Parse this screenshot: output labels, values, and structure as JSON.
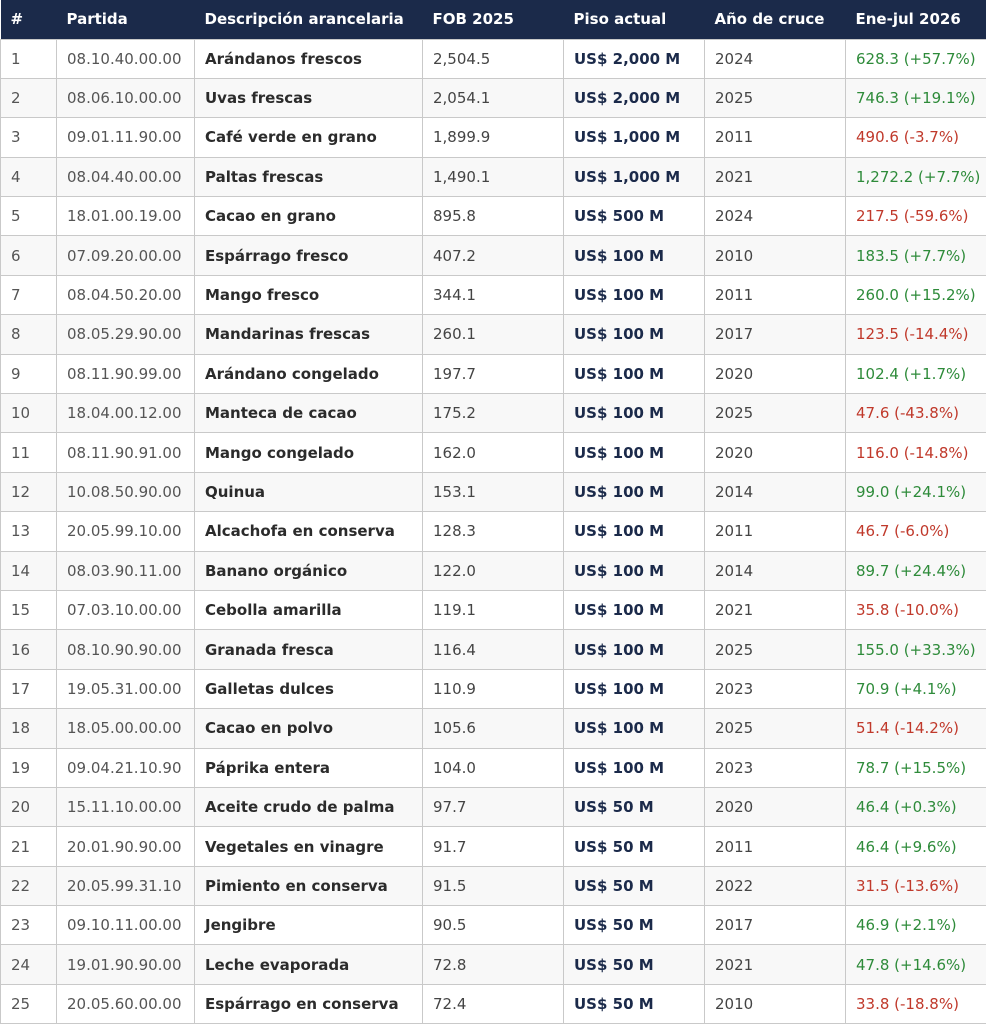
{
  "table": {
    "headers": [
      "#",
      "Partida",
      "Descripción arancelaria",
      "FOB 2025",
      "Piso actual",
      "Año de cruce",
      "Ene-jul 2026"
    ],
    "rows": [
      {
        "idx": "1",
        "partida": "08.10.40.00.00",
        "desc": "Arándanos frescos",
        "fob": "2,504.5",
        "piso": "US$ 2,000 M",
        "year": "2024",
        "ytd": "628.3  (+57.7%)",
        "trend": "pos"
      },
      {
        "idx": "2",
        "partida": "08.06.10.00.00",
        "desc": "Uvas frescas",
        "fob": "2,054.1",
        "piso": "US$ 2,000 M",
        "year": "2025",
        "ytd": "746.3  (+19.1%)",
        "trend": "pos"
      },
      {
        "idx": "3",
        "partida": "09.01.11.90.00",
        "desc": "Café verde en grano",
        "fob": "1,899.9",
        "piso": "US$ 1,000 M",
        "year": "2011",
        "ytd": "490.6  (-3.7%)",
        "trend": "neg"
      },
      {
        "idx": "4",
        "partida": "08.04.40.00.00",
        "desc": "Paltas frescas",
        "fob": "1,490.1",
        "piso": "US$ 1,000 M",
        "year": "2021",
        "ytd": "1,272.2  (+7.7%)",
        "trend": "pos"
      },
      {
        "idx": "5",
        "partida": "18.01.00.19.00",
        "desc": "Cacao en grano",
        "fob": "895.8",
        "piso": "US$ 500 M",
        "year": "2024",
        "ytd": "217.5  (-59.6%)",
        "trend": "neg"
      },
      {
        "idx": "6",
        "partida": "07.09.20.00.00",
        "desc": "Espárrago fresco",
        "fob": "407.2",
        "piso": "US$ 100 M",
        "year": "2010",
        "ytd": "183.5  (+7.7%)",
        "trend": "pos"
      },
      {
        "idx": "7",
        "partida": "08.04.50.20.00",
        "desc": "Mango fresco",
        "fob": "344.1",
        "piso": "US$ 100 M",
        "year": "2011",
        "ytd": "260.0  (+15.2%)",
        "trend": "pos"
      },
      {
        "idx": "8",
        "partida": "08.05.29.90.00",
        "desc": "Mandarinas frescas",
        "fob": "260.1",
        "piso": "US$ 100 M",
        "year": "2017",
        "ytd": "123.5  (-14.4%)",
        "trend": "neg"
      },
      {
        "idx": "9",
        "partida": "08.11.90.99.00",
        "desc": "Arándano congelado",
        "fob": "197.7",
        "piso": "US$ 100 M",
        "year": "2020",
        "ytd": "102.4  (+1.7%)",
        "trend": "pos"
      },
      {
        "idx": "10",
        "partida": "18.04.00.12.00",
        "desc": "Manteca de cacao",
        "fob": "175.2",
        "piso": "US$ 100 M",
        "year": "2025",
        "ytd": "47.6  (-43.8%)",
        "trend": "neg"
      },
      {
        "idx": "11",
        "partida": "08.11.90.91.00",
        "desc": "Mango congelado",
        "fob": "162.0",
        "piso": "US$ 100 M",
        "year": "2020",
        "ytd": "116.0  (-14.8%)",
        "trend": "neg"
      },
      {
        "idx": "12",
        "partida": "10.08.50.90.00",
        "desc": "Quinua",
        "fob": "153.1",
        "piso": "US$ 100 M",
        "year": "2014",
        "ytd": "99.0  (+24.1%)",
        "trend": "pos"
      },
      {
        "idx": "13",
        "partida": "20.05.99.10.00",
        "desc": "Alcachofa en conserva",
        "fob": "128.3",
        "piso": "US$ 100 M",
        "year": "2011",
        "ytd": "46.7  (-6.0%)",
        "trend": "neg"
      },
      {
        "idx": "14",
        "partida": "08.03.90.11.00",
        "desc": "Banano orgánico",
        "fob": "122.0",
        "piso": "US$ 100 M",
        "year": "2014",
        "ytd": "89.7  (+24.4%)",
        "trend": "pos"
      },
      {
        "idx": "15",
        "partida": "07.03.10.00.00",
        "desc": "Cebolla amarilla",
        "fob": "119.1",
        "piso": "US$ 100 M",
        "year": "2021",
        "ytd": "35.8  (-10.0%)",
        "trend": "neg"
      },
      {
        "idx": "16",
        "partida": "08.10.90.90.00",
        "desc": "Granada fresca",
        "fob": "116.4",
        "piso": "US$ 100 M",
        "year": "2025",
        "ytd": "155.0  (+33.3%)",
        "trend": "pos"
      },
      {
        "idx": "17",
        "partida": "19.05.31.00.00",
        "desc": "Galletas dulces",
        "fob": "110.9",
        "piso": "US$ 100 M",
        "year": "2023",
        "ytd": "70.9  (+4.1%)",
        "trend": "pos"
      },
      {
        "idx": "18",
        "partida": "18.05.00.00.00",
        "desc": "Cacao en polvo",
        "fob": "105.6",
        "piso": "US$ 100 M",
        "year": "2025",
        "ytd": "51.4  (-14.2%)",
        "trend": "neg"
      },
      {
        "idx": "19",
        "partida": "09.04.21.10.90",
        "desc": "Páprika entera",
        "fob": "104.0",
        "piso": "US$ 100 M",
        "year": "2023",
        "ytd": "78.7  (+15.5%)",
        "trend": "pos"
      },
      {
        "idx": "20",
        "partida": "15.11.10.00.00",
        "desc": "Aceite crudo de palma",
        "fob": "97.7",
        "piso": "US$ 50 M",
        "year": "2020",
        "ytd": "46.4  (+0.3%)",
        "trend": "pos"
      },
      {
        "idx": "21",
        "partida": "20.01.90.90.00",
        "desc": "Vegetales en vinagre",
        "fob": "91.7",
        "piso": "US$ 50 M",
        "year": "2011",
        "ytd": "46.4  (+9.6%)",
        "trend": "pos"
      },
      {
        "idx": "22",
        "partida": "20.05.99.31.10",
        "desc": "Pimiento en conserva",
        "fob": "91.5",
        "piso": "US$ 50 M",
        "year": "2022",
        "ytd": "31.5  (-13.6%)",
        "trend": "neg"
      },
      {
        "idx": "23",
        "partida": "09.10.11.00.00",
        "desc": "Jengibre",
        "fob": "90.5",
        "piso": "US$ 50 M",
        "year": "2017",
        "ytd": "46.9  (+2.1%)",
        "trend": "pos"
      },
      {
        "idx": "24",
        "partida": "19.01.90.90.00",
        "desc": "Leche evaporada",
        "fob": "72.8",
        "piso": "US$ 50 M",
        "year": "2021",
        "ytd": "47.8  (+14.6%)",
        "trend": "pos"
      },
      {
        "idx": "25",
        "partida": "20.05.60.00.00",
        "desc": "Espárrago en conserva",
        "fob": "72.4",
        "piso": "US$ 50 M",
        "year": "2010",
        "ytd": "33.8  (-18.8%)",
        "trend": "neg"
      }
    ],
    "colors": {
      "header_bg": "#1b2a4a",
      "positive": "#2e8b3a",
      "negative": "#c0392b",
      "piso": "#1b2a4a"
    }
  }
}
